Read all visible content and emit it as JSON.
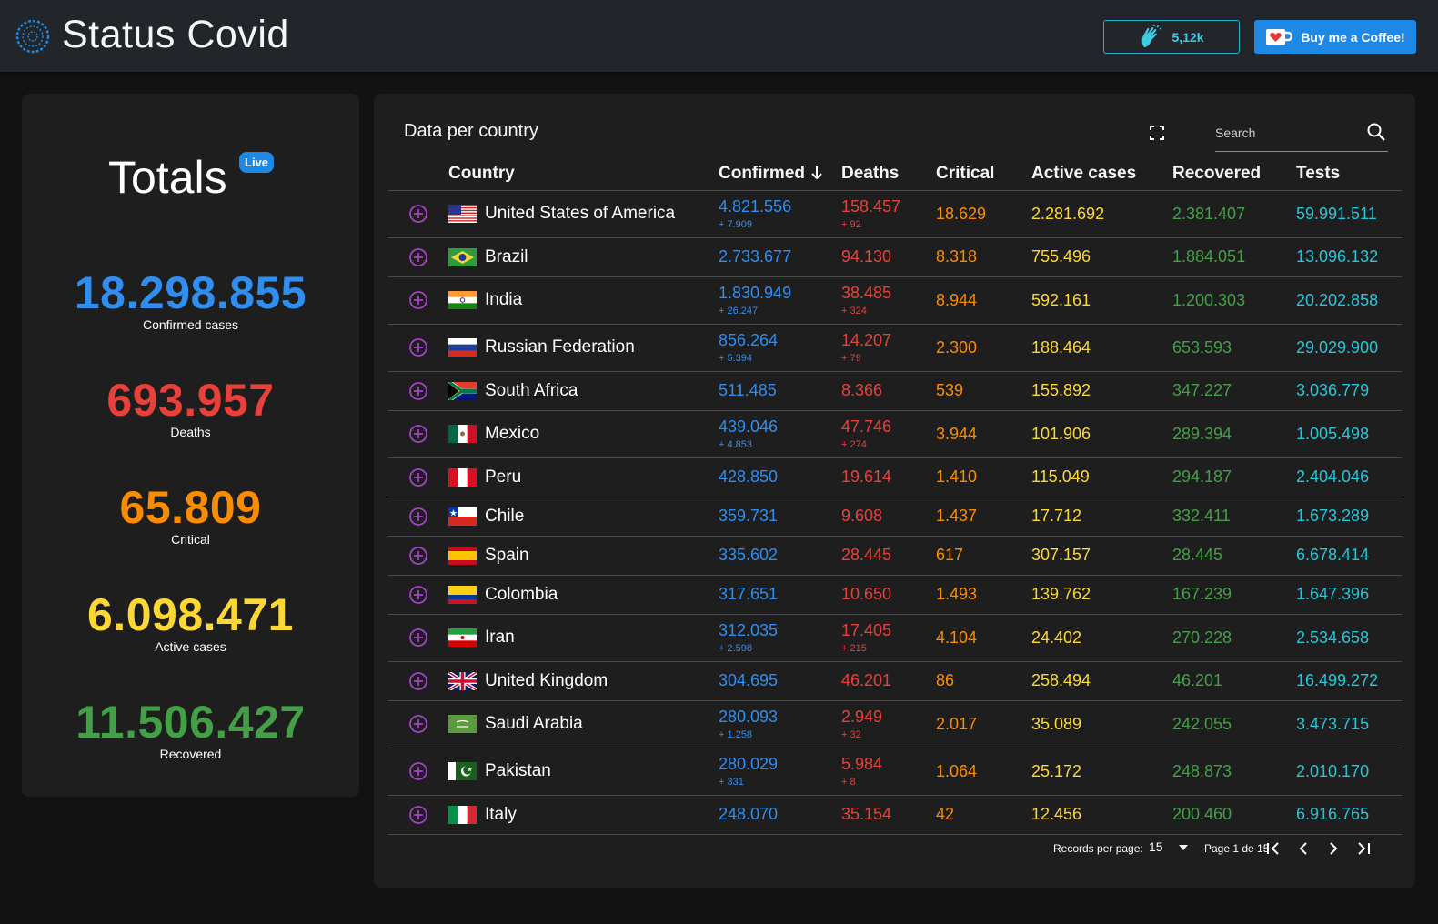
{
  "header": {
    "title": "Status Covid",
    "claps": "5,12k",
    "coffee_label": "Buy me a Coffee!"
  },
  "totals": {
    "title": "Totals",
    "live": "Live",
    "confirmed": {
      "value": "18.298.855",
      "label": "Confirmed cases"
    },
    "deaths": {
      "value": "693.957",
      "label": "Deaths"
    },
    "critical": {
      "value": "65.809",
      "label": "Critical"
    },
    "active": {
      "value": "6.098.471",
      "label": "Active cases"
    },
    "recovered": {
      "value": "11.506.427",
      "label": "Recovered"
    }
  },
  "colors": {
    "confirmed": "#2f8ef0",
    "deaths": "#e8413b",
    "critical": "#fb8c00",
    "active": "#fdd835",
    "recovered": "#43a047",
    "tests": "#26c6da",
    "expand": "#a640c9",
    "accent": "#1e88e5"
  },
  "table": {
    "title": "Data per country",
    "search_placeholder": "Search",
    "columns": {
      "country": "Country",
      "confirmed": "Confirmed",
      "deaths": "Deaths",
      "critical": "Critical",
      "active": "Active cases",
      "recovered": "Recovered",
      "tests": "Tests"
    },
    "rows": [
      {
        "country": "United States of America",
        "flag": "us",
        "confirmed": "4.821.556",
        "confirmed_delta": "+ 7.909",
        "deaths": "158.457",
        "deaths_delta": "+ 92",
        "critical": "18.629",
        "active": "2.281.692",
        "recovered": "2.381.407",
        "tests": "59.991.511"
      },
      {
        "country": "Brazil",
        "flag": "br",
        "confirmed": "2.733.677",
        "confirmed_delta": "",
        "deaths": "94.130",
        "deaths_delta": "",
        "critical": "8.318",
        "active": "755.496",
        "recovered": "1.884.051",
        "tests": "13.096.132"
      },
      {
        "country": "India",
        "flag": "in",
        "confirmed": "1.830.949",
        "confirmed_delta": "+ 26.247",
        "deaths": "38.485",
        "deaths_delta": "+ 324",
        "critical": "8.944",
        "active": "592.161",
        "recovered": "1.200.303",
        "tests": "20.202.858"
      },
      {
        "country": "Russian Federation",
        "flag": "ru",
        "confirmed": "856.264",
        "confirmed_delta": "+ 5.394",
        "deaths": "14.207",
        "deaths_delta": "+ 79",
        "critical": "2.300",
        "active": "188.464",
        "recovered": "653.593",
        "tests": "29.029.900"
      },
      {
        "country": "South Africa",
        "flag": "za",
        "confirmed": "511.485",
        "confirmed_delta": "",
        "deaths": "8.366",
        "deaths_delta": "",
        "critical": "539",
        "active": "155.892",
        "recovered": "347.227",
        "tests": "3.036.779"
      },
      {
        "country": "Mexico",
        "flag": "mx",
        "confirmed": "439.046",
        "confirmed_delta": "+ 4.853",
        "deaths": "47.746",
        "deaths_delta": "+ 274",
        "critical": "3.944",
        "active": "101.906",
        "recovered": "289.394",
        "tests": "1.005.498"
      },
      {
        "country": "Peru",
        "flag": "pe",
        "confirmed": "428.850",
        "confirmed_delta": "",
        "deaths": "19.614",
        "deaths_delta": "",
        "critical": "1.410",
        "active": "115.049",
        "recovered": "294.187",
        "tests": "2.404.046"
      },
      {
        "country": "Chile",
        "flag": "cl",
        "confirmed": "359.731",
        "confirmed_delta": "",
        "deaths": "9.608",
        "deaths_delta": "",
        "critical": "1.437",
        "active": "17.712",
        "recovered": "332.411",
        "tests": "1.673.289"
      },
      {
        "country": "Spain",
        "flag": "es",
        "confirmed": "335.602",
        "confirmed_delta": "",
        "deaths": "28.445",
        "deaths_delta": "",
        "critical": "617",
        "active": "307.157",
        "recovered": "28.445",
        "tests": "6.678.414"
      },
      {
        "country": "Colombia",
        "flag": "co",
        "confirmed": "317.651",
        "confirmed_delta": "",
        "deaths": "10.650",
        "deaths_delta": "",
        "critical": "1.493",
        "active": "139.762",
        "recovered": "167.239",
        "tests": "1.647.396"
      },
      {
        "country": "Iran",
        "flag": "ir",
        "confirmed": "312.035",
        "confirmed_delta": "+ 2.598",
        "deaths": "17.405",
        "deaths_delta": "+ 215",
        "critical": "4.104",
        "active": "24.402",
        "recovered": "270.228",
        "tests": "2.534.658"
      },
      {
        "country": "United Kingdom",
        "flag": "gb",
        "confirmed": "304.695",
        "confirmed_delta": "",
        "deaths": "46.201",
        "deaths_delta": "",
        "critical": "86",
        "active": "258.494",
        "recovered": "46.201",
        "tests": "16.499.272"
      },
      {
        "country": "Saudi Arabia",
        "flag": "sa",
        "confirmed": "280.093",
        "confirmed_delta": "+ 1.258",
        "deaths": "2.949",
        "deaths_delta": "+ 32",
        "critical": "2.017",
        "active": "35.089",
        "recovered": "242.055",
        "tests": "3.473.715"
      },
      {
        "country": "Pakistan",
        "flag": "pk",
        "confirmed": "280.029",
        "confirmed_delta": "+ 331",
        "deaths": "5.984",
        "deaths_delta": "+ 8",
        "critical": "1.064",
        "active": "25.172",
        "recovered": "248.873",
        "tests": "2.010.170"
      },
      {
        "country": "Italy",
        "flag": "it",
        "confirmed": "248.070",
        "confirmed_delta": "",
        "deaths": "35.154",
        "deaths_delta": "",
        "critical": "42",
        "active": "12.456",
        "recovered": "200.460",
        "tests": "6.916.765"
      }
    ]
  },
  "pagination": {
    "records_label": "Records per page:",
    "records_value": "15",
    "page_info": "Page 1 de 15"
  }
}
